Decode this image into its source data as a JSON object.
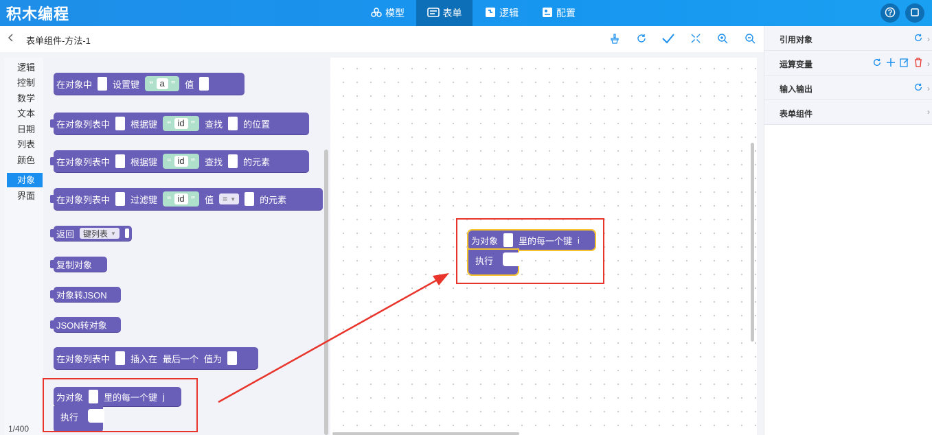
{
  "app": {
    "title": "积木编程"
  },
  "nav": {
    "tabs": [
      {
        "label": "模型",
        "icon": "model-icon"
      },
      {
        "label": "表单",
        "icon": "form-icon",
        "active": true
      },
      {
        "label": "逻辑",
        "icon": "logic-icon"
      },
      {
        "label": "配置",
        "icon": "config-icon"
      }
    ]
  },
  "header": {
    "breadcrumb": "表单组件-方法-1"
  },
  "toolbox": {
    "categories": [
      "逻辑",
      "控制",
      "数学",
      "文本",
      "日期",
      "列表",
      "颜色",
      "对象",
      "界面"
    ],
    "active": "对象",
    "page_count": "1/400"
  },
  "blocks": {
    "set_key": {
      "p1": "在对象中",
      "p2": "设置键",
      "key": "a",
      "p3": "值"
    },
    "find_pos": {
      "p1": "在对象列表中",
      "p2": "根据键",
      "key": "id",
      "p3": "查找",
      "p4": "的位置"
    },
    "find_elem": {
      "p1": "在对象列表中",
      "p2": "根据键",
      "key": "id",
      "p3": "查找",
      "p4": "的元素"
    },
    "filter": {
      "p1": "在对象列表中",
      "p2": "过滤键",
      "key": "id",
      "p3": "值",
      "op": "=",
      "p4": "的元素"
    },
    "return_keys": {
      "p1": "返回",
      "dd": "键列表"
    },
    "copy_obj": {
      "p1": "复制对象"
    },
    "obj_to_json": {
      "p1": "对象转JSON"
    },
    "json_to_obj": {
      "p1": "JSON转对象"
    },
    "insert": {
      "p1": "在对象列表中",
      "p2": "插入在",
      "p3": "最后一个",
      "p4": "值为"
    },
    "foreach_flyout": {
      "p1": "为对象",
      "p2": "里的每一个键",
      "var": "j",
      "do": "执行"
    },
    "foreach_canvas": {
      "p1": "为对象",
      "p2": "里的每一个键",
      "var": "i",
      "do": "执行"
    }
  },
  "right_panel": {
    "items": [
      {
        "label": "引用对象"
      },
      {
        "label": "运算变量"
      },
      {
        "label": "输入输出"
      },
      {
        "label": "表单组件"
      }
    ]
  },
  "colors": {
    "topbar": "#1a8fed",
    "active_tab": "#0d6fb8",
    "block": "#6a5fb8",
    "string_block": "#aee0cc",
    "highlight": "#e8342a",
    "selected_outline": "#f5c32c"
  }
}
